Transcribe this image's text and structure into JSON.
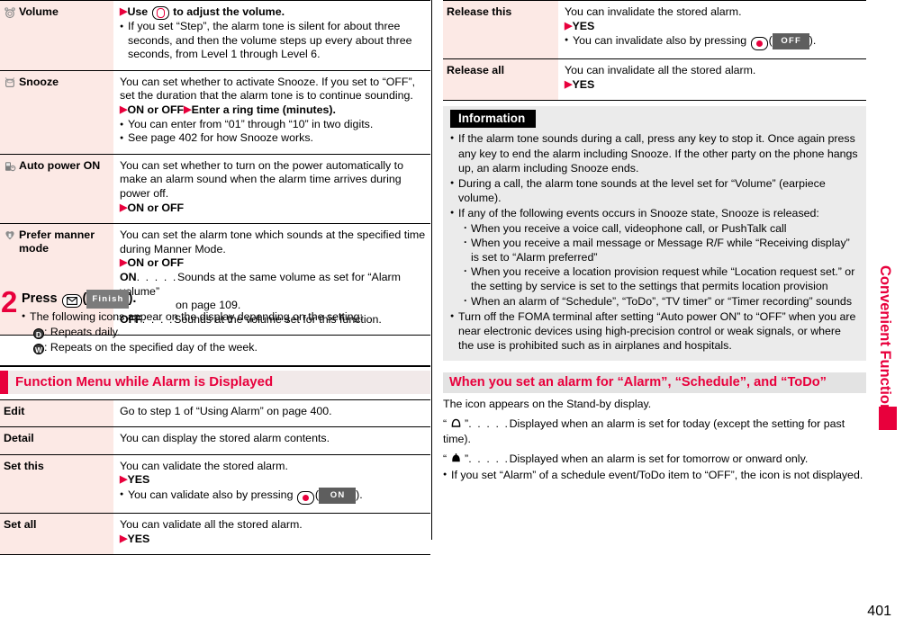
{
  "page": {
    "number": "401",
    "side_tab": "Convenient Functions"
  },
  "settings_table": {
    "rows": [
      {
        "icon": "alarm-clock-icon",
        "term": "Volume",
        "lines": [
          {
            "type": "arrow-bold",
            "text": "Use  to adjust the volume.",
            "pre": "Use",
            "post": "to adjust the volume."
          },
          {
            "type": "bullet",
            "text": "If you set “Step”, the alarm tone is silent for about three seconds, and then the volume steps up every about three seconds, from Level 1 through Level 6."
          }
        ]
      },
      {
        "icon": "snooze-clock-icon",
        "term": "Snooze",
        "lines": [
          {
            "type": "plain",
            "text": "You can set whether to activate Snooze. If you set to “OFF”, set the duration that the alarm tone is to continue sounding."
          },
          {
            "type": "arrow-bold-2",
            "a": "ON or OFF",
            "b": "Enter a ring time (minutes)."
          },
          {
            "type": "bullet",
            "text": "You can enter from “01” through “10” in two digits."
          },
          {
            "type": "bullet",
            "text": "See page 402 for how Snooze works."
          }
        ]
      },
      {
        "icon": "phone-power-icon",
        "term": "Auto power ON",
        "lines": [
          {
            "type": "plain",
            "text": "You can set whether to turn on the power automatically to make an alarm sound when the alarm time arrives during power off."
          },
          {
            "type": "arrow-bold",
            "post": "ON or OFF"
          }
        ]
      },
      {
        "icon": "manner-mode-icon",
        "term": "Prefer manner mode",
        "lines": [
          {
            "type": "plain",
            "text": "You can set the alarm tone which sounds at the specified time during Manner Mode."
          },
          {
            "type": "arrow-bold",
            "post": "ON or OFF"
          },
          {
            "type": "def",
            "label": "ON",
            "dots": ". . . . .",
            "text": "Sounds at the same volume as set for “Alarm volume”",
            "cont": "on page 109."
          },
          {
            "type": "def",
            "label": "OFF",
            "dots": ". . . .",
            "text": "Sounds at the volume set for this function."
          }
        ]
      }
    ]
  },
  "step": {
    "number": "2",
    "head_pre": "Press",
    "head_key": "mail-key-icon",
    "soft_label": "Finish",
    "head_post": ").",
    "bullet": "The following icons appear on the display depending on the setting:",
    "icons": [
      {
        "glyph": "D",
        "text": ": Repeats daily."
      },
      {
        "glyph": "W",
        "text": ": Repeats on the specified day of the week."
      }
    ]
  },
  "function_menu": {
    "heading": "Function Menu while Alarm is Displayed",
    "rows": [
      {
        "term": "Edit",
        "lines": [
          {
            "type": "plain",
            "text": "Go to step 1 of “Using Alarm” on page 400."
          }
        ]
      },
      {
        "term": "Detail",
        "lines": [
          {
            "type": "plain",
            "text": "You can display the stored alarm contents."
          }
        ]
      },
      {
        "term": "Set this",
        "lines": [
          {
            "type": "plain",
            "text": "You can validate the stored alarm."
          },
          {
            "type": "arrow-bold",
            "post": "YES"
          },
          {
            "type": "bullet-key",
            "pre": "You can validate also by pressing",
            "soft": "ON",
            "post": ")."
          }
        ]
      },
      {
        "term": "Set all",
        "lines": [
          {
            "type": "plain",
            "text": "You can validate all the stored alarm."
          },
          {
            "type": "arrow-bold",
            "post": "YES"
          }
        ]
      }
    ]
  },
  "function_menu_right": {
    "rows": [
      {
        "term": "Release this",
        "lines": [
          {
            "type": "plain",
            "text": "You can invalidate the stored alarm."
          },
          {
            "type": "arrow-bold",
            "post": "YES"
          },
          {
            "type": "bullet-key",
            "pre": "You can invalidate also by pressing",
            "soft": "OFF",
            "post": ")."
          }
        ]
      },
      {
        "term": "Release all",
        "lines": [
          {
            "type": "plain",
            "text": "You can invalidate all the stored alarm."
          },
          {
            "type": "arrow-bold",
            "post": "YES"
          }
        ]
      }
    ]
  },
  "information": {
    "title": "Information",
    "items": [
      {
        "type": "bullet",
        "text": "If the alarm tone sounds during a call, press any key to stop it. Once again press any key to end the alarm including Snooze. If the other party on the phone hangs up, an alarm including Snooze ends."
      },
      {
        "type": "bullet",
        "text": "During a call, the alarm tone sounds at the level set for “Volume” (earpiece volume)."
      },
      {
        "type": "bullet",
        "text": "If any of the following events occurs in Snooze state, Snooze is released:"
      },
      {
        "type": "sub",
        "text": "When you receive a voice call, videophone call, or PushTalk call"
      },
      {
        "type": "sub",
        "text": "When you receive a mail message or Message R/F while “Receiving display” is set to “Alarm preferred”"
      },
      {
        "type": "sub",
        "text": "When you receive a location provision request while “Location request set.” or the setting by service is set to the settings that permits location provision"
      },
      {
        "type": "sub",
        "text": "When an alarm of “Schedule”, “ToDo”, “TV timer” or “Timer recording” sounds"
      },
      {
        "type": "bullet",
        "text": "Turn off the FOMA terminal after setting “Auto power ON” to “OFF” when you are near electronic devices using high-precision control or weak signals, or where the use is prohibited such as in airplanes and hospitals."
      }
    ]
  },
  "alarm_icon_section": {
    "heading": "When you set an alarm for “Alarm”, “Schedule”, and “ToDo”",
    "intro": "The icon appears on the Stand-by display.",
    "entries": [
      {
        "icon": "bell-outline-icon",
        "dots": ". . . . .",
        "text": "Displayed when an alarm is set for today (except the setting for past time)."
      },
      {
        "icon": "bell-solid-icon",
        "dots": ". . . . .",
        "text": "Displayed when an alarm is set for tomorrow or onward only."
      }
    ],
    "note": "If you set “Alarm” of a schedule event/ToDo item to “OFF”, the icon is not displayed."
  },
  "colors": {
    "accent_red": "#e8003c",
    "term_bg": "#fce9e5",
    "info_bg": "#ebebeb",
    "heading_bg": "#e3e3e3"
  }
}
